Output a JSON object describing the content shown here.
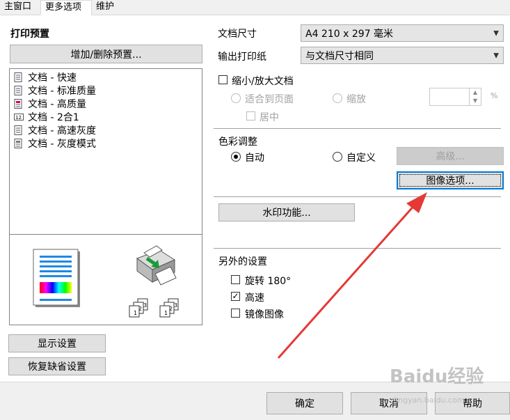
{
  "tabs": [
    {
      "label": "主窗口"
    },
    {
      "label": "更多选项"
    },
    {
      "label": "维护"
    }
  ],
  "presets": {
    "title": "打印预置",
    "add_remove_button": "增加/删除预置...",
    "items": [
      {
        "label": "文档 - 快速"
      },
      {
        "label": "文档 - 标准质量"
      },
      {
        "label": "文档 - 高质量"
      },
      {
        "label": "文档 - 2合1"
      },
      {
        "label": "文档 - 高速灰度"
      },
      {
        "label": "文档 - 灰度模式"
      }
    ]
  },
  "paper": {
    "doc_size_label": "文档尺寸",
    "doc_size_value": "A4 210 x 297 毫米",
    "output_paper_label": "输出打印纸",
    "output_paper_value": "与文档尺寸相同",
    "reduce_enlarge_label": "缩小/放大文档",
    "fit_to_page_label": "适合到页面",
    "zoom_label": "缩放",
    "zoom_value": "",
    "percent": "%",
    "center_label": "居中"
  },
  "color": {
    "title": "色彩调整",
    "auto_label": "自动",
    "custom_label": "自定义",
    "advanced_button": "高级...",
    "image_options_button": "图像选项..."
  },
  "watermark_button": "水印功能...",
  "extra": {
    "title": "另外的设置",
    "rotate_label": "旋转 180°",
    "high_speed_label": "高速",
    "mirror_label": "镜像图像",
    "rotate_checked": false,
    "high_speed_checked": true,
    "mirror_checked": false
  },
  "left_buttons": {
    "show_settings": "显示设置",
    "restore_defaults": "恢复缺省设置"
  },
  "footer": {
    "ok": "确定",
    "cancel": "取消",
    "help": "帮助"
  },
  "watermark_text": {
    "brand": "Baidu经验",
    "url": "jingyan.baidu.com"
  },
  "colors": {
    "arrow": "#e53935",
    "focus": "#0078d7"
  },
  "icons": {
    "preset_doc": "document-icon",
    "preset_2in1": "two-in-one-icon",
    "preview_page": "page-preview-icon",
    "printer": "printer-icon",
    "collate": "collate-icon",
    "check": "✓"
  }
}
